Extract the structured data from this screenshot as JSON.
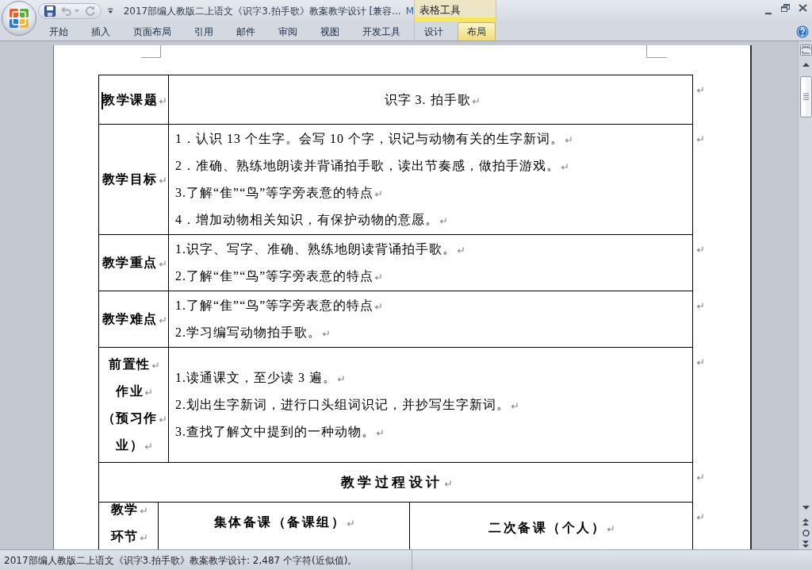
{
  "window": {
    "title": "2017部编人教版二上语文《识字3.拍手歌》教案教学设计 [兼容...",
    "title_fragment": "M"
  },
  "quick_access": [
    {
      "kind": "save",
      "disabled": false
    },
    {
      "kind": "undo",
      "disabled": true
    },
    {
      "kind": "redo",
      "disabled": true
    }
  ],
  "ribbon": {
    "contextual_group": "表格工具",
    "tabs": [
      {
        "label": "开始",
        "selected": false,
        "contextual": false
      },
      {
        "label": "插入",
        "selected": false,
        "contextual": false
      },
      {
        "label": "页面布局",
        "selected": false,
        "contextual": false
      },
      {
        "label": "引用",
        "selected": false,
        "contextual": false
      },
      {
        "label": "邮件",
        "selected": false,
        "contextual": false
      },
      {
        "label": "审阅",
        "selected": false,
        "contextual": false
      },
      {
        "label": "视图",
        "selected": false,
        "contextual": false
      },
      {
        "label": "开发工具",
        "selected": false,
        "contextual": false
      },
      {
        "label": "设计",
        "selected": false,
        "contextual": true
      },
      {
        "label": "布局",
        "selected": true,
        "contextual": true
      }
    ]
  },
  "document": {
    "show_formatting_marks": true,
    "table": {
      "rows": [
        {
          "kind": "title",
          "cursor": true,
          "label": [
            "教学课题"
          ],
          "cells": [
            {
              "colspan": 2,
              "paragraphs": [
                "识字 3. 拍手歌"
              ]
            }
          ]
        },
        {
          "kind": "field",
          "cursor": false,
          "label": [
            "教学目标"
          ],
          "cells": [
            {
              "colspan": 2,
              "paragraphs": [
                "1．认识 13 个生字。会写 10 个字，识记与动物有关的生字新词。",
                "2．准确、熟练地朗读并背诵拍手歌，读出节奏感，做拍手游戏。",
                "3.了解“隹”“鸟”等字旁表意的特点",
                "4．增加动物相关知识，有保护动物的意愿。"
              ]
            }
          ]
        },
        {
          "kind": "field",
          "cursor": false,
          "label": [
            "教学重点"
          ],
          "cells": [
            {
              "colspan": 2,
              "paragraphs": [
                "1.识字、写字、准确、熟练地朗读背诵拍手歌。",
                "2.了解“隹”“鸟”等字旁表意的特点"
              ]
            }
          ]
        },
        {
          "kind": "field",
          "cursor": false,
          "label": [
            "教学难点"
          ],
          "cells": [
            {
              "colspan": 2,
              "paragraphs": [
                "1.了解“隹”“鸟”等字旁表意的特点",
                "2.学习编写动物拍手歌。"
              ]
            }
          ]
        },
        {
          "kind": "field",
          "cursor": false,
          "label": [
            "前置性",
            "作业",
            "（预习作",
            "业）"
          ],
          "cells": [
            {
              "colspan": 2,
              "paragraphs": [
                "1.读通课文，至少读 3 遍。",
                "2.划出生字新词，进行口头组词识记，并抄写生字新词。",
                "3.查找了解文中提到的一种动物。"
              ]
            }
          ]
        },
        {
          "kind": "section",
          "cursor": false,
          "cells": [
            {
              "colspan": 3,
              "paragraphs": [
                "教学过程设计"
              ]
            }
          ]
        },
        {
          "kind": "columns",
          "cursor": false,
          "label": [
            "教学",
            "环节"
          ],
          "cells": [
            {
              "paragraphs": [
                "集体备课（备课组）"
              ]
            },
            {
              "paragraphs": [
                "二次备课（个人）"
              ]
            }
          ]
        }
      ]
    }
  },
  "status_bar": {
    "text": "2017部编人教版二上语文《识字3.拍手歌》教案教学设计: 2,487 个字符(近似值)。"
  }
}
